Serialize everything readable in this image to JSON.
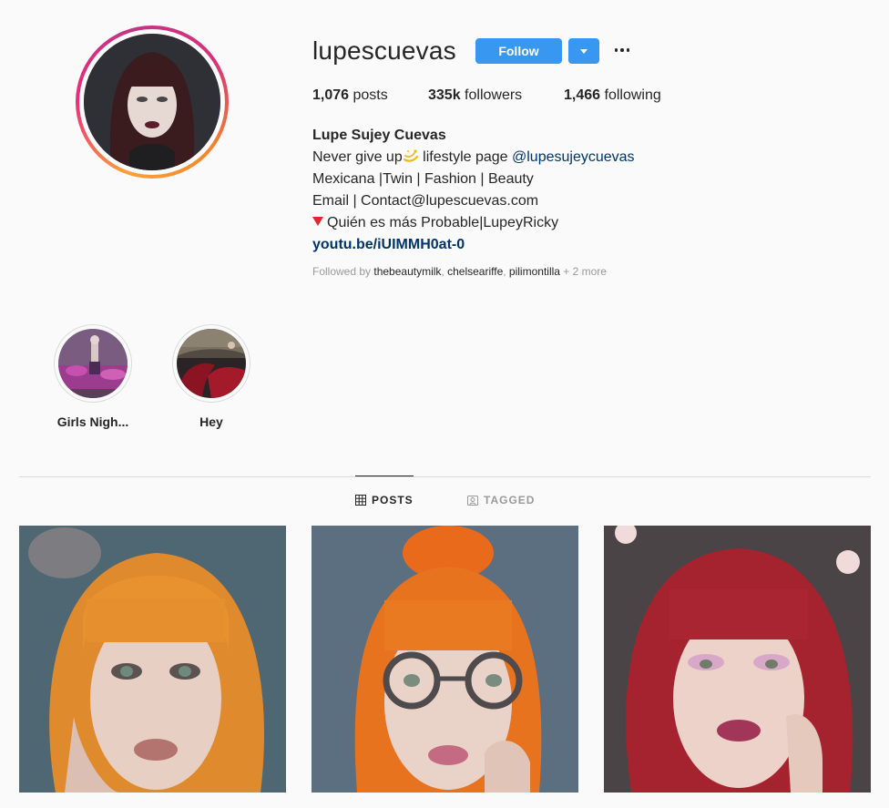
{
  "profile": {
    "username": "lupescuevas",
    "follow_label": "Follow",
    "posts_count": "1,076",
    "posts_label": " posts",
    "followers_count": "335k",
    "followers_label": " followers",
    "following_count": "1,466",
    "following_label": " following"
  },
  "bio": {
    "name": "Lupe Sujey Cuevas",
    "line1_before": "Never give up",
    "line1_middle": " lifestyle page ",
    "line1_mention": "@lupesujeycuevas",
    "line2": "Mexicana |Twin | Fashion | Beauty",
    "line3": "Email | Contact@lupescuevas.com",
    "line4": "Quién es más Probable|LupeyRicky",
    "link": "youtu.be/iUIMMH0at-0"
  },
  "followed_by": {
    "prefix": "Followed by ",
    "accounts": [
      "thebeautymilk",
      "chelseariffe",
      "pilimontilla"
    ],
    "sep": ", ",
    "more": " + 2 more"
  },
  "highlights": [
    {
      "label": "Girls Nigh..."
    },
    {
      "label": "Hey"
    }
  ],
  "tabs": {
    "posts": "POSTS",
    "tagged": "TAGGED"
  },
  "colors": {
    "accent": "#3897f0",
    "link": "#003569",
    "divider": "#dbdbdb"
  },
  "icons": [
    "more-icon",
    "dropdown-icon",
    "grid-icon",
    "tag-icon",
    "sparkle-icon",
    "red-triangle-icon"
  ]
}
